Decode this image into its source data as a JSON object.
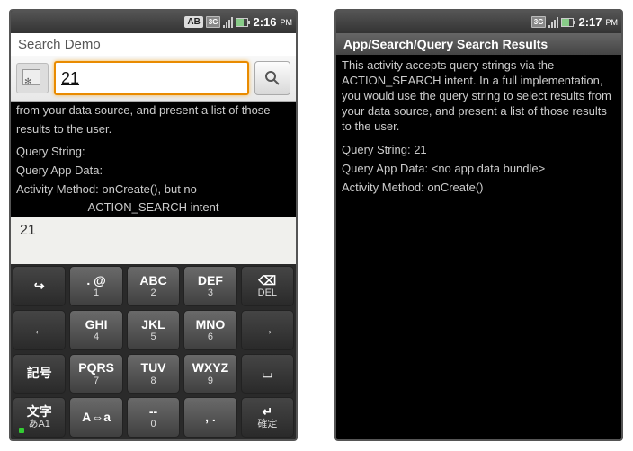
{
  "left": {
    "status": {
      "ab": "AB",
      "net": "3G",
      "time": "2:16",
      "ampm": "PM"
    },
    "header_title": "Search Demo",
    "search_value": "21",
    "body_partial1": "from your data source, and present a list of those",
    "body_partial2": "results to the user.",
    "query_string_label": "Query String:",
    "query_appdata_label": "Query App Data:",
    "activity_method_line1": "Activity Method: onCreate(), but no",
    "activity_method_line2": "ACTION_SEARCH intent",
    "suggestion": "21",
    "keys": {
      "r1": [
        "↪",
        ". @",
        "ABC",
        "DEF",
        "⌫"
      ],
      "r1sub": [
        "",
        "1",
        "2",
        "3",
        "DEL"
      ],
      "r2": [
        "←",
        "GHI",
        "JKL",
        "MNO",
        "→"
      ],
      "r2sub": [
        "",
        "4",
        "5",
        "6",
        ""
      ],
      "r3": [
        "記号",
        "PQRS",
        "TUV",
        "WXYZ",
        "⌴"
      ],
      "r3sub": [
        "",
        "7",
        "8",
        "9",
        ""
      ],
      "r4": [
        "文字",
        "A⇔a",
        "--",
        ", .",
        "↵"
      ],
      "r4sub": [
        "あA1",
        "",
        "0",
        "",
        "確定"
      ]
    }
  },
  "right": {
    "status": {
      "net": "3G",
      "time": "2:17",
      "ampm": "PM"
    },
    "title": "App/Search/Query Search Results",
    "para": "This activity accepts query strings via the ACTION_SEARCH intent. In a full implementation, you would use the query string to select results from your data source, and present a list of those results to the user.",
    "query_string": "Query String: 21",
    "query_appdata": "Query App Data: <no app data bundle>",
    "activity_method": "Activity Method: onCreate()"
  }
}
